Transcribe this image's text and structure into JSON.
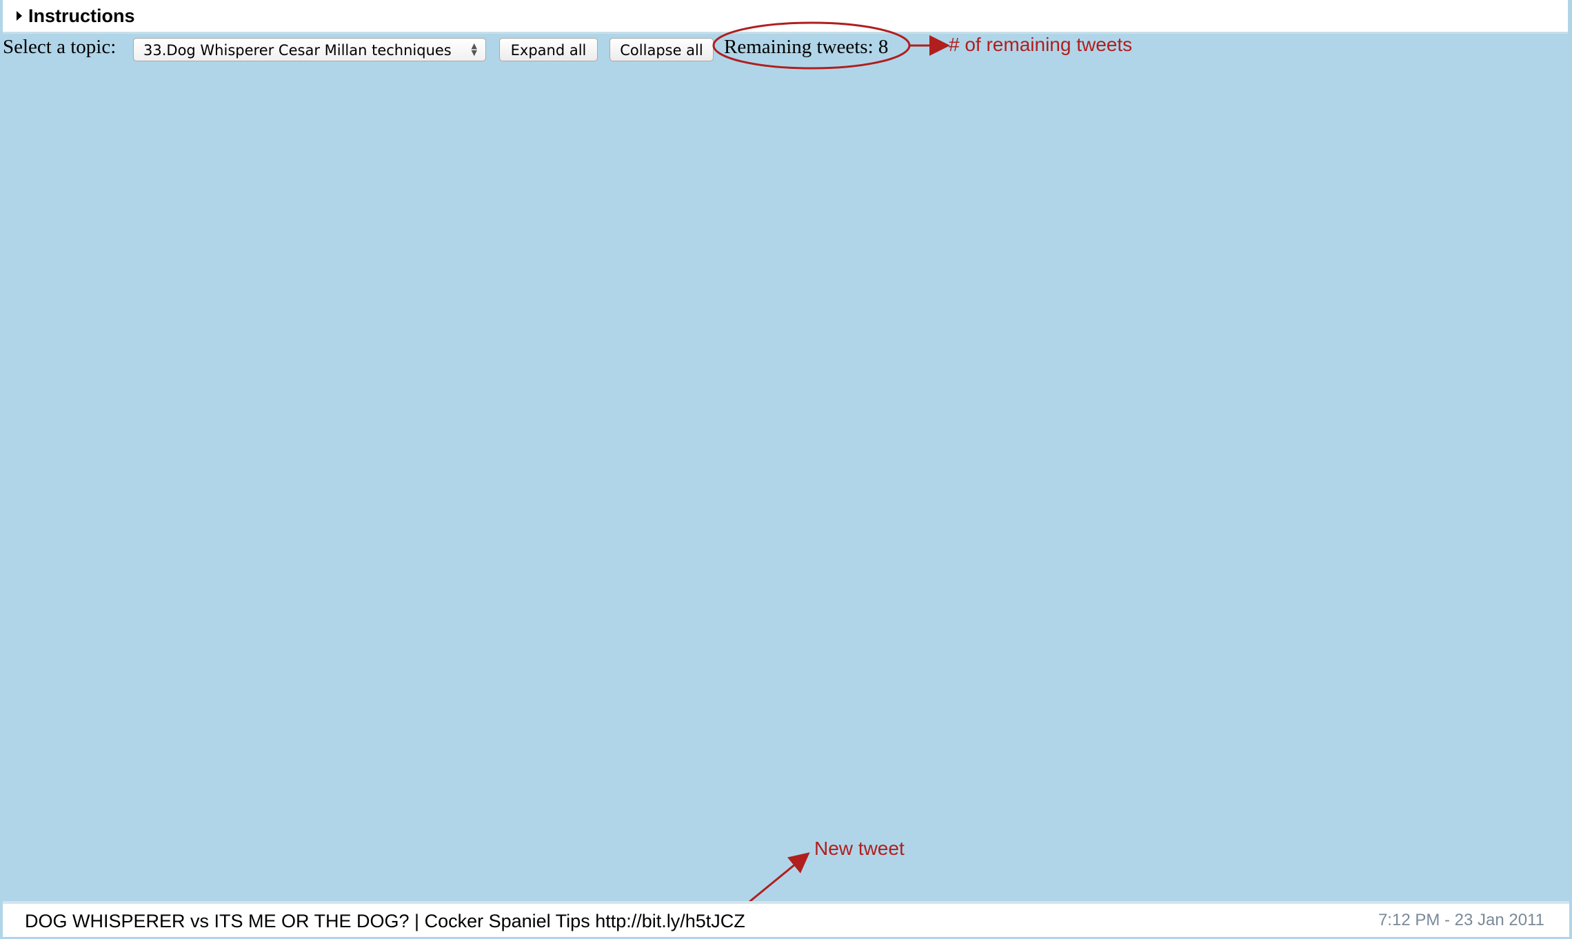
{
  "instructions": {
    "label": "Instructions",
    "icon": "disclosure-triangle-right-icon"
  },
  "toolbar": {
    "topic_label": "Select a topic:",
    "topic_selected": "33.Dog Whisperer Cesar Millan techniques",
    "expand_all": "Expand all",
    "collapse_all": "Collapse all",
    "remaining": "Remaining tweets: 8"
  },
  "annotations": {
    "remaining_note": "# of remaining tweets",
    "new_tweet_note": "New tweet",
    "color": "#b01e1e"
  },
  "tweet": {
    "text": "DOG WHISPERER vs ITS ME OR THE DOG? | Cocker Spaniel Tips http://bit.ly/h5tJCZ",
    "time": "7:12 PM - 23 Jan 2011"
  },
  "colors": {
    "background": "#b0d5e8"
  }
}
